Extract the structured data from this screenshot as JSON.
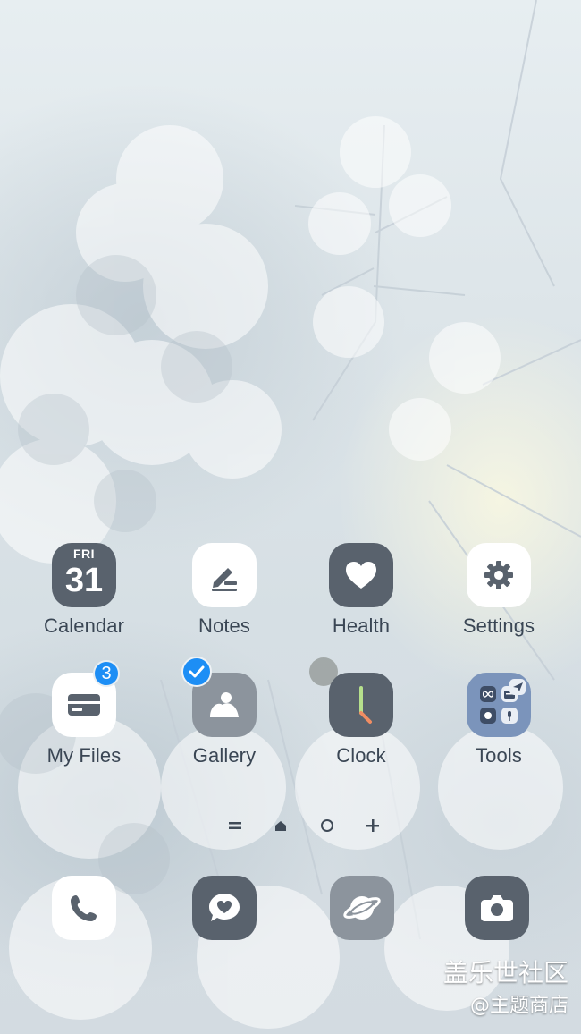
{
  "home": {
    "row1": [
      {
        "label": "Calendar",
        "icon": "calendar-icon",
        "day": "FRI",
        "date": "31"
      },
      {
        "label": "Notes",
        "icon": "notes-pen-icon"
      },
      {
        "label": "Health",
        "icon": "heart-icon"
      },
      {
        "label": "Settings",
        "icon": "gear-icon"
      }
    ],
    "row2": [
      {
        "label": "My Files",
        "icon": "folder-card-icon",
        "badge": "3"
      },
      {
        "label": "Gallery",
        "icon": "gallery-icon",
        "selected": true
      },
      {
        "label": "Clock",
        "icon": "clock-icon"
      },
      {
        "label": "Tools",
        "icon": "tools-folder-icon"
      }
    ]
  },
  "pager": {
    "items": [
      "menu-page-icon",
      "home-page-icon",
      "page-dot-icon",
      "add-page-icon"
    ]
  },
  "dock": [
    {
      "icon": "phone-icon"
    },
    {
      "icon": "messages-icon"
    },
    {
      "icon": "browser-planet-icon"
    },
    {
      "icon": "camera-icon"
    }
  ],
  "watermark": {
    "line1": "盖乐世社区",
    "line2": "@主题商店"
  },
  "colors": {
    "label_text": "#3a4654",
    "dark_tile": "#59626d",
    "badge_blue": "#1d8ef5",
    "folder_blue": "#7b94bb"
  }
}
